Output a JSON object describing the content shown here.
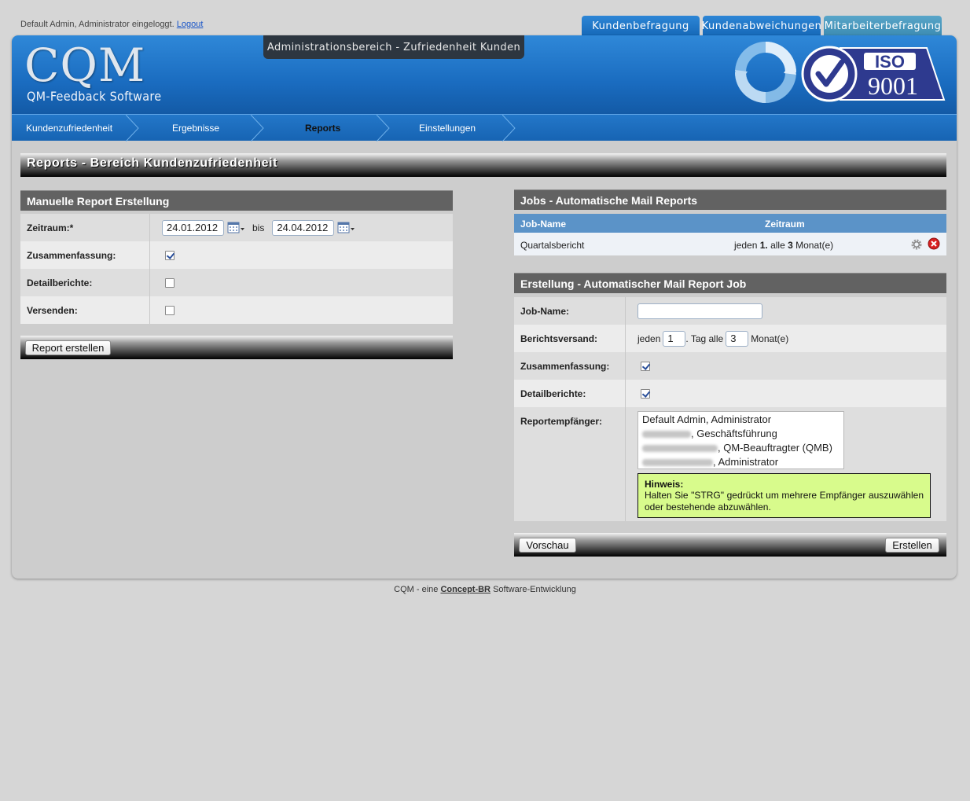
{
  "login": {
    "text": "Default Admin, Administrator eingeloggt.",
    "logout": "Logout"
  },
  "top_tabs": [
    "Kundenbefragung",
    "Kundenabweichungen",
    "Mitarbeiterbefragung"
  ],
  "header": {
    "logo": "CQM",
    "logo_sub": "QM-Feedback Software",
    "admin_title": "Administrationsbereich - Zufriedenheit Kunden",
    "iso_label": "ISO",
    "iso_number": "9001"
  },
  "nav": {
    "items": [
      "Kundenzufriedenheit",
      "Ergebnisse",
      "Reports",
      "Einstellungen"
    ],
    "active": "Reports"
  },
  "page_title": "Reports - Bereich Kundenzufriedenheit",
  "manual": {
    "title": "Manuelle Report Erstellung",
    "zeitraum_label": "Zeitraum:*",
    "date_from": "24.01.2012",
    "bis": "bis",
    "date_to": "24.04.2012",
    "zusammenfassung_label": "Zusammenfassung:",
    "detail_label": "Detailberichte:",
    "versenden_label": "Versenden:",
    "button": "Report erstellen"
  },
  "jobs": {
    "title": "Jobs - Automatische Mail Reports",
    "col_name": "Job-Name",
    "col_range": "Zeitraum",
    "rows": [
      {
        "name": "Quartalsbericht",
        "range_pre": "jeden",
        "day": "1.",
        "range_mid": "alle",
        "months": "3",
        "range_post": "Monat(e)"
      }
    ]
  },
  "create": {
    "title": "Erstellung - Automatischer Mail Report Job",
    "jobname_label": "Job-Name:",
    "jobname_value": "",
    "versand_label": "Berichtsversand:",
    "versand_pre": "jeden",
    "versand_day": "1",
    "versand_mid": ". Tag alle",
    "versand_months": "3",
    "versand_post": "Monat(e)",
    "zusammenfassung_label": "Zusammenfassung:",
    "detail_label": "Detailberichte:",
    "empfaenger_label": "Reportempfänger:",
    "recipients": [
      {
        "prefix": "",
        "text": "Default Admin, Administrator"
      },
      {
        "prefix": "",
        "text": ", Geschäftsführung"
      },
      {
        "prefix": "",
        "text": ", QM-Beauftragter (QMB)"
      },
      {
        "prefix": "",
        "text": ", Administrator"
      }
    ],
    "hint_title": "Hinweis:",
    "hint_text": "Halten Sie \"STRG\" gedrückt um mehrere Empfänger auszuwählen oder bestehende abzuwählen.",
    "preview_button": "Vorschau",
    "create_button": "Erstellen"
  },
  "footer": {
    "pre": "CQM - eine",
    "link": "Concept-BR",
    "post": "Software-Entwicklung"
  },
  "colors": {
    "header_blue": "#1a6cc0",
    "hint_bg": "#d8fb8c",
    "panel_head": "#626262"
  }
}
